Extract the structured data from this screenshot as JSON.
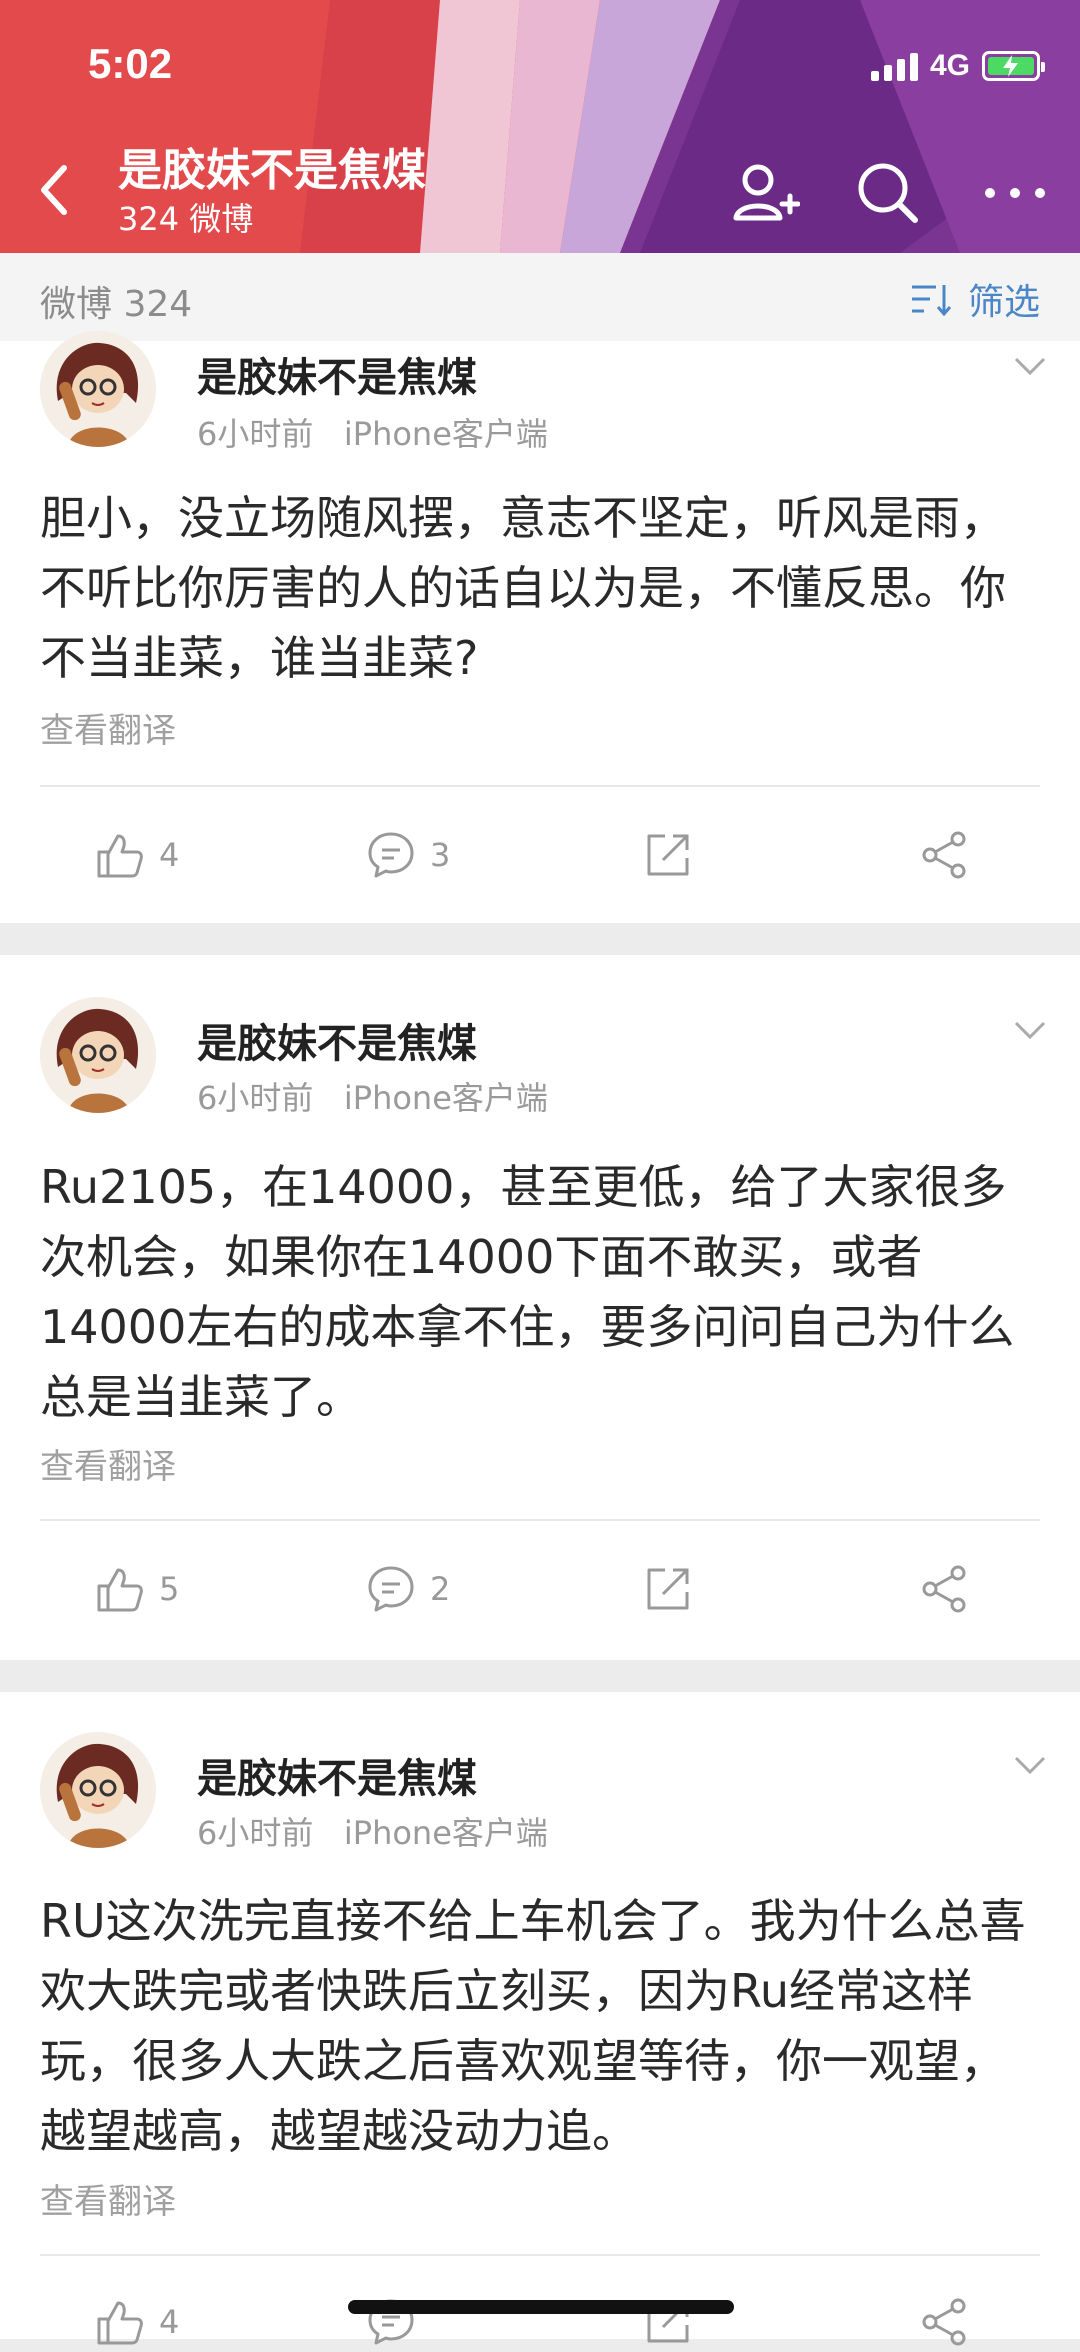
{
  "status": {
    "time": "5:02",
    "network": "4G"
  },
  "header": {
    "title": "是胶妹不是焦煤",
    "subtitle": "324 微博"
  },
  "filter": {
    "count_label": "微博 324",
    "filter_label": "筛选"
  },
  "posts": [
    {
      "author": "是胶妹不是焦煤",
      "meta": "6小时前   iPhone客户端",
      "content": "胆小，没立场随风摆，意志不坚定，听风是雨，不听比你厉害的人的话自以为是，不懂反思。你不当韭菜，谁当韭菜?",
      "translate": "查看翻译",
      "likes": "4",
      "comments": "3"
    },
    {
      "author": "是胶妹不是焦煤",
      "meta": "6小时前   iPhone客户端",
      "content": "Ru2105，在14000，甚至更低，给了大家很多次机会，如果你在14000下面不敢买，或者14000左右的成本拿不住，要多问问自己为什么总是当韭菜了。",
      "translate": "查看翻译",
      "likes": "5",
      "comments": "2"
    },
    {
      "author": "是胶妹不是焦煤",
      "meta": "6小时前   iPhone客户端",
      "content": "RU这次洗完直接不给上车机会了。我为什么总喜欢大跌完或者快跌后立刻买，因为Ru经常这样玩，很多人大跌之后喜欢观望等待，你一观望，越望越高，越望越没动力追。",
      "translate": "查看翻译",
      "likes": "4",
      "comments": ""
    }
  ],
  "colors": {
    "accent": "#4a86c8",
    "header_red": "#e8504a",
    "header_purple": "#6a2a8a"
  }
}
